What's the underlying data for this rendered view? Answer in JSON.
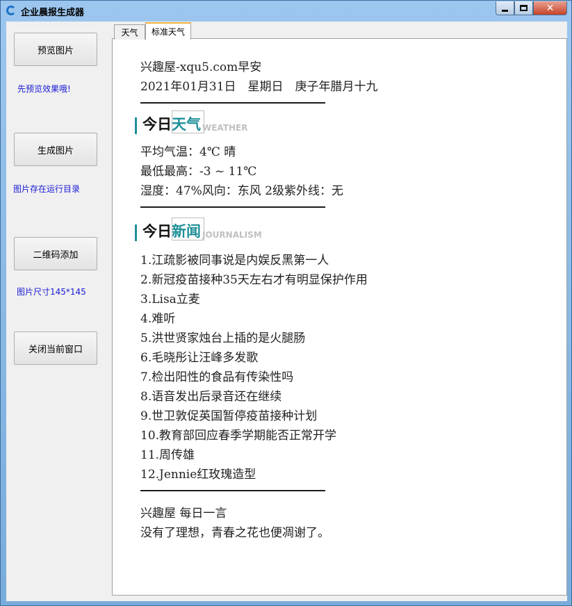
{
  "window": {
    "title": "企业晨报生成器",
    "close_glyph": "✕"
  },
  "sidebar": {
    "buttons": [
      {
        "label": "预览图片"
      },
      {
        "label": "生成图片"
      },
      {
        "label": "二维码添加"
      },
      {
        "label": "关闭当前窗口"
      }
    ],
    "hints": [
      "先预览效果哦!",
      "图片存在运行目录",
      "图片尺寸145*145"
    ]
  },
  "tabs": [
    {
      "label": "天气",
      "selected": false
    },
    {
      "label": "标准天气",
      "selected": true
    }
  ],
  "report": {
    "greeting": "兴趣屋-xqu5.com早安",
    "date_line": "2021年01月31日　星期日　庚子年腊月十九",
    "weather_head": {
      "black": "今日",
      "teal": "天气",
      "en": "WEATHER"
    },
    "weather_lines": [
      "平均气温：4℃ 晴",
      "最低最高：-3 ~ 11℃",
      "湿度：47%风向：东风 2级紫外线：无"
    ],
    "news_head": {
      "black": "今日",
      "teal": "新闻",
      "en": "JOURNALISM"
    },
    "news": [
      "1.江疏影被同事说是内娱反黑第一人",
      "2.新冠疫苗接种35天左右才有明显保护作用",
      "3.Lisa立麦",
      "4.难听",
      "5.洪世贤家烛台上插的是火腿肠",
      "6.毛晓彤让汪峰多发歌",
      "7.检出阳性的食品有传染性吗",
      "8.语音发出后录音还在继续",
      "9.世卫敦促英国暂停疫苗接种计划",
      "10.教育部回应春季学期能否正常开学",
      "11.周传雄",
      "12.Jennie红玫瑰造型"
    ],
    "quote_title": "兴趣屋 每日一言",
    "quote": "没有了理想，青春之花也便凋谢了。"
  }
}
